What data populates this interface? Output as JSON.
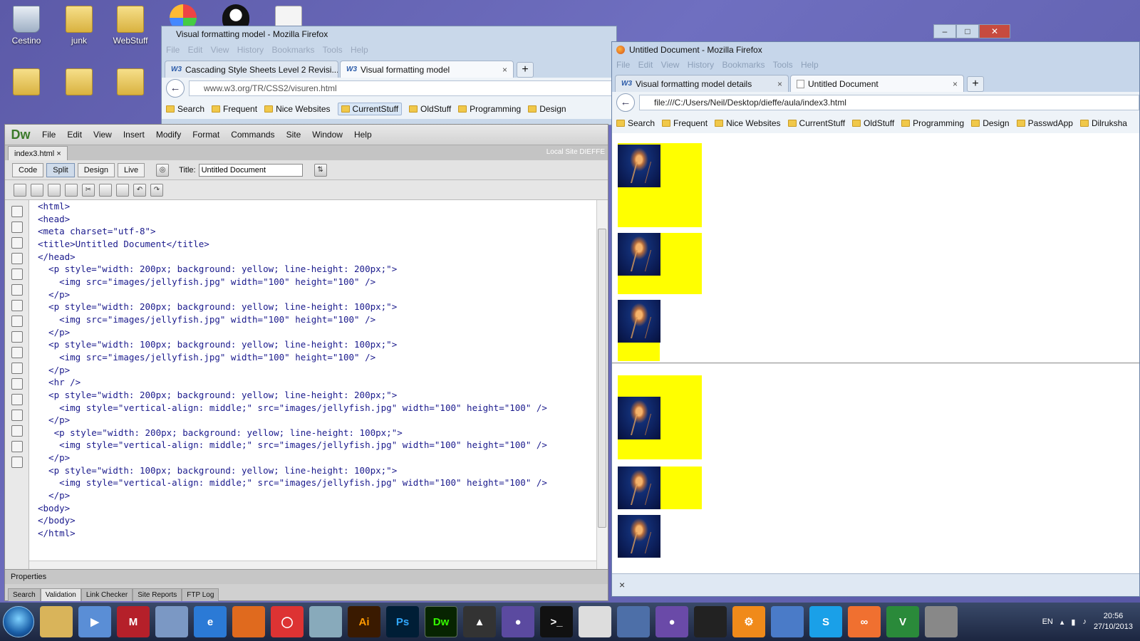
{
  "desktop": {
    "icons": [
      {
        "label": "Cestino"
      },
      {
        "label": "junk"
      },
      {
        "label": "WebStuff"
      }
    ]
  },
  "w3_window": {
    "title": "Visual formatting model - Mozilla Firefox",
    "menu": "File Edit View History Bookmarks Tools Help",
    "tabs": [
      "Cascading Style Sheets Level 2 Revisi...",
      "Visual formatting model"
    ],
    "url": "www.w3.org/TR/CSS2/visuren.html",
    "bookmarks": [
      "Search",
      "Frequent",
      "Nice Websites",
      "CurrentStuff",
      "OldStuff",
      "Programming",
      "Design"
    ]
  },
  "dreamweaver": {
    "logo": "Dw",
    "menu": [
      "File",
      "Edit",
      "View",
      "Insert",
      "Modify",
      "Format",
      "Commands",
      "Site",
      "Window",
      "Help"
    ],
    "doc_tab": "index3.html",
    "site_label": "Local Site DIEFFE",
    "views": [
      "Code",
      "Split",
      "Design",
      "Live"
    ],
    "title_label": "Title:",
    "title_value": "Untitled Document",
    "code": "<html>\n<head>\n<meta charset=\"utf-8\">\n<title>Untitled Document</title>\n</head>\n  <p style=\"width: 200px; background: yellow; line-height: 200px;\">\n    <img src=\"images/jellyfish.jpg\" width=\"100\" height=\"100\" />\n  </p>\n  <p style=\"width: 200px; background: yellow; line-height: 100px;\">\n    <img src=\"images/jellyfish.jpg\" width=\"100\" height=\"100\" />\n  </p>\n  <p style=\"width: 100px; background: yellow; line-height: 100px;\">\n    <img src=\"images/jellyfish.jpg\" width=\"100\" height=\"100\" />\n  </p>\n  <hr />\n  <p style=\"width: 200px; background: yellow; line-height: 200px;\">\n    <img style=\"vertical-align: middle;\" src=\"images/jellyfish.jpg\" width=\"100\" height=\"100\" />\n  </p>\n   <p style=\"width: 200px; background: yellow; line-height: 100px;\">\n    <img style=\"vertical-align: middle;\" src=\"images/jellyfish.jpg\" width=\"100\" height=\"100\" />\n  </p>\n  <p style=\"width: 100px; background: yellow; line-height: 100px;\">\n    <img style=\"vertical-align: middle;\" src=\"images/jellyfish.jpg\" width=\"100\" height=\"100\" />\n  </p>\n<body>\n</body>\n</html>",
    "panel_title": "Properties",
    "panel_tabs": [
      "Search",
      "Validation",
      "Link Checker",
      "Site Reports",
      "FTP Log"
    ]
  },
  "firefox": {
    "title": "Untitled Document - Mozilla Firefox",
    "menu": "File Edit View History Bookmarks Tools Help",
    "tabs": [
      "Visual formatting model details",
      "Untitled Document"
    ],
    "url": "file:///C:/Users/Neil/Desktop/dieffe/aula/index3.html",
    "bookmarks": [
      "Search",
      "Frequent",
      "Nice Websites",
      "CurrentStuff",
      "OldStuff",
      "Programming",
      "Design",
      "PasswdApp",
      "Dilruksha"
    ],
    "findbar_close": "×"
  },
  "taskbar": {
    "apps": [
      "Ai",
      "Ps",
      "Dw"
    ],
    "lang": "EN",
    "time": "20:56",
    "date": "27/10/2013"
  },
  "colors": {
    "yellow": "#ffff00",
    "accent": "#3b7a2a"
  }
}
